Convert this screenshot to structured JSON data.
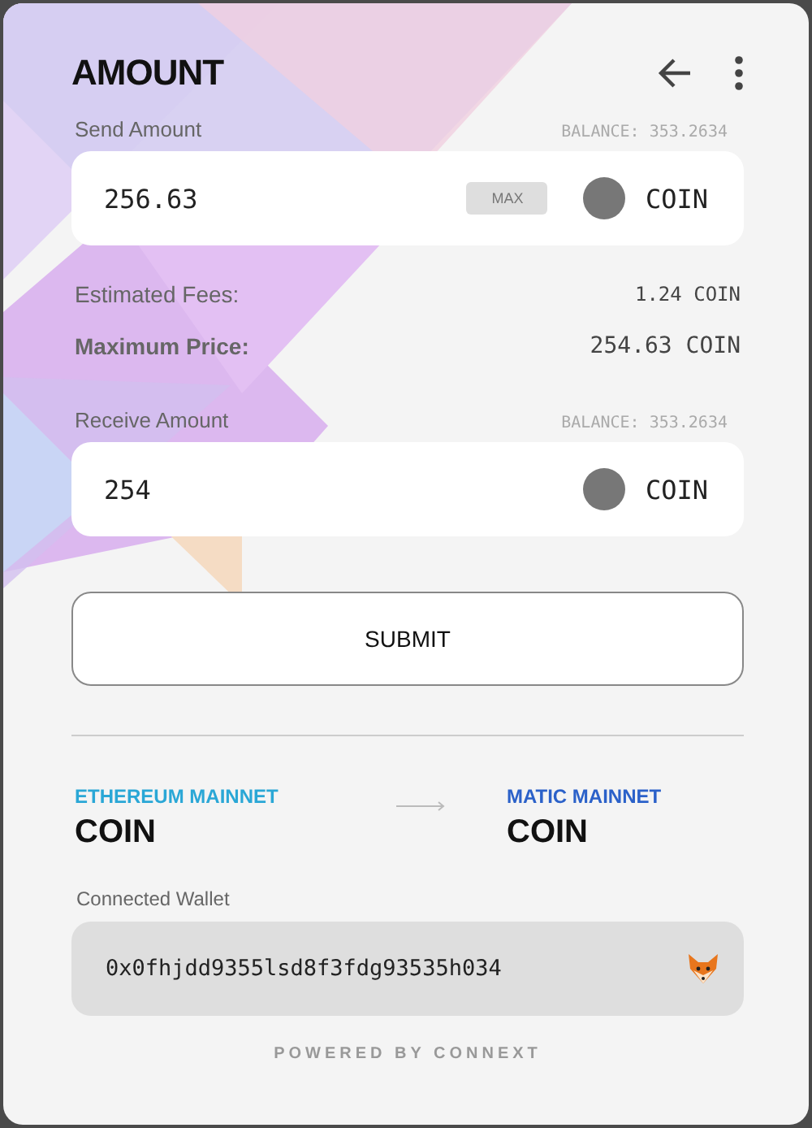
{
  "header": {
    "title": "AMOUNT"
  },
  "send": {
    "label": "Send Amount",
    "balance": "BALANCE: 353.2634",
    "value": "256.63",
    "max_button": "MAX",
    "token": "COIN"
  },
  "fees": [
    {
      "kind": "normal",
      "label": "Estimated Fees:",
      "value": "1.24 COIN"
    },
    {
      "kind": "strong",
      "label": "Maximum Price:",
      "value": "254.63 COIN"
    }
  ],
  "receive": {
    "label": "Receive Amount",
    "balance": "BALANCE: 353.2634",
    "value": "254",
    "token": "COIN"
  },
  "submit_button": "SUBMIT",
  "networks": [
    {
      "name": "ETHEREUM MAINNET",
      "token": "COIN",
      "color": "#2aa7d6"
    },
    {
      "name": "MATIC MAINNET",
      "token": "COIN",
      "color": "#2b61c9"
    }
  ],
  "wallet": {
    "label": "Connected Wallet",
    "address": "0x0fhjdd9355lsd8f3fdg93535h034"
  },
  "footer": "POWERED BY CONNEXT"
}
